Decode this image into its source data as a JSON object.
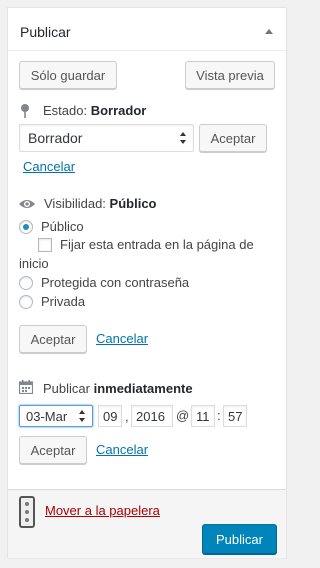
{
  "panel": {
    "title": "Publicar"
  },
  "buttons": {
    "save_draft": "Sólo guardar",
    "preview": "Vista previa",
    "accept": "Aceptar",
    "publish": "Publicar"
  },
  "status": {
    "label": "Estado:",
    "value": "Borrador",
    "select_value": "Borrador",
    "cancel": "Cancelar"
  },
  "visibility": {
    "label": "Visibilidad:",
    "value": "Público",
    "options": [
      {
        "label": "Público",
        "checked": true
      },
      {
        "label": "Protegida con contraseña",
        "checked": false
      },
      {
        "label": "Privada",
        "checked": false
      }
    ],
    "sticky_label_line1": "Fijar esta entrada en la página de",
    "sticky_label_line2": "inicio",
    "cancel": "Cancelar"
  },
  "schedule": {
    "label": "Publicar",
    "value": "inmediatamente",
    "month": "03-Mar",
    "day": "09",
    "year": "2016",
    "at": "@",
    "hour": "11",
    "minute": "57",
    "cancel": "Cancelar"
  },
  "footer": {
    "trash": "Mover a la papelera"
  },
  "colors": {
    "primary": "#0085ba",
    "link": "#0073aa",
    "danger": "#a00000"
  }
}
